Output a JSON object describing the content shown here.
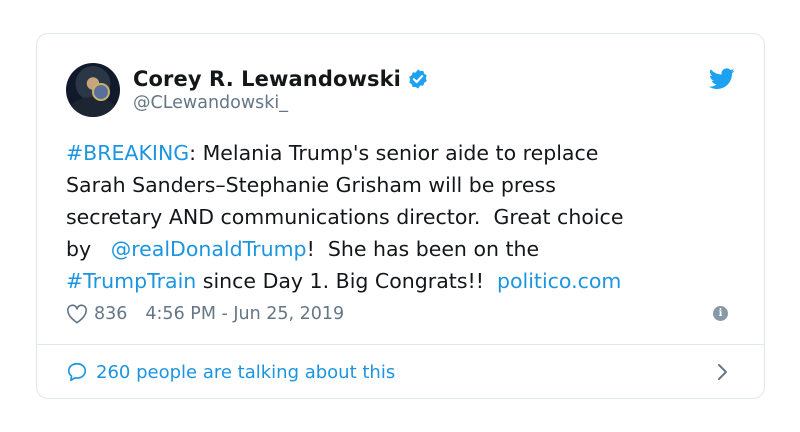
{
  "author": {
    "display_name": "Corey R. Lewandowski",
    "handle": "@CLewandowski_"
  },
  "tweet": {
    "hashtag_breaking": "#BREAKING",
    "text_1": ": Melania Trump's senior aide to replace\nSarah Sanders–Stephanie Grisham will be press\nsecretary AND communications director.  Great choice\nby   ",
    "mention": "@realDonaldTrump",
    "text_2": "!  She has been on the\n",
    "hashtag_train": "#TrumpTrain",
    "text_3": " since Day 1. Big Congrats!!  ",
    "link": "politico.com"
  },
  "meta": {
    "likes": "836",
    "timestamp": "4:56 PM - Jun 25, 2019",
    "info_glyph": "i"
  },
  "footer": {
    "talking": "260 people are talking about this"
  },
  "colors": {
    "link": "#1b95e0",
    "verified": "#1da1f2",
    "muted": "#657786"
  },
  "icons": [
    "avatar",
    "verified-badge-icon",
    "twitter-bird-icon",
    "heart-icon",
    "info-icon",
    "speech-bubble-icon",
    "chevron-right-icon"
  ]
}
